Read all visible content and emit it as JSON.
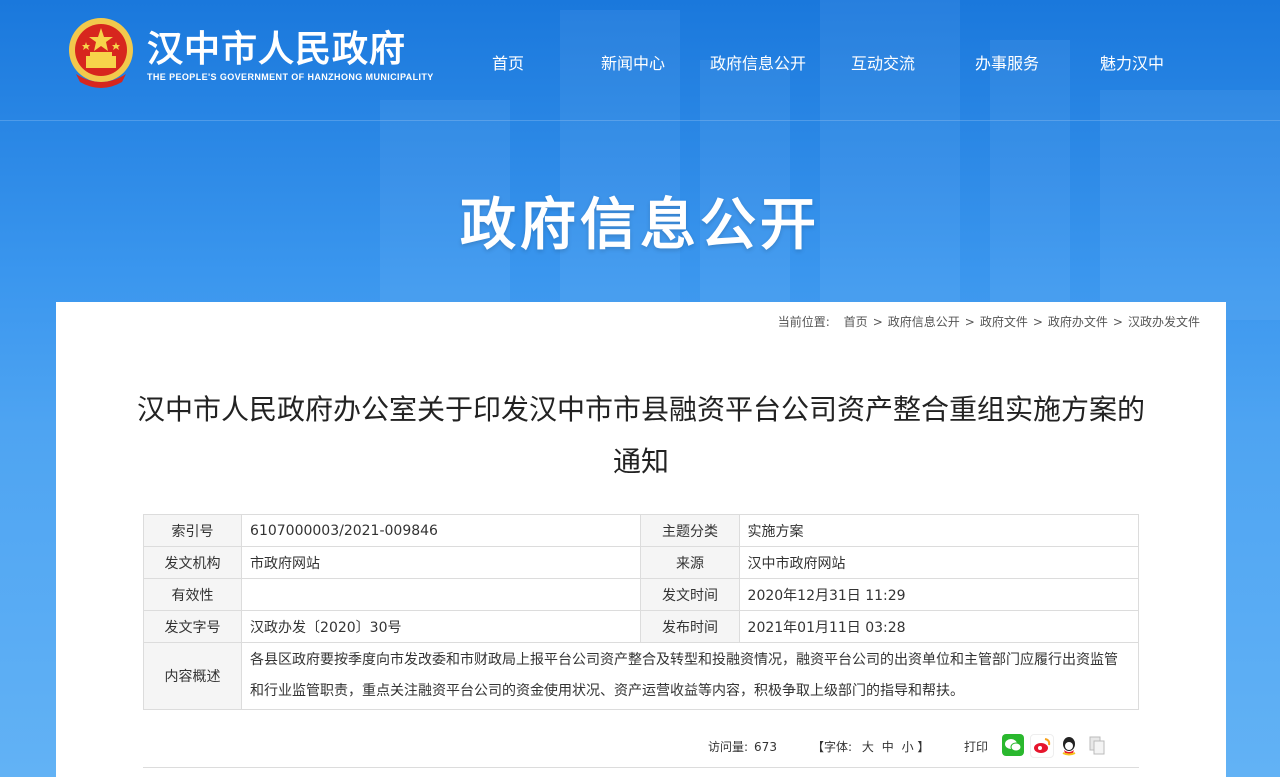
{
  "site": {
    "title": "汉中市人民政府",
    "subtitle": "THE PEOPLE'S GOVERNMENT OF HANZHONG MUNICIPALITY"
  },
  "nav": [
    {
      "label": "首页"
    },
    {
      "label": "新闻中心"
    },
    {
      "label": "政府信息公开"
    },
    {
      "label": "互动交流"
    },
    {
      "label": "办事服务"
    },
    {
      "label": "魅力汉中"
    }
  ],
  "banner": {
    "title": "政府信息公开"
  },
  "breadcrumb": {
    "prefix": "当前位置:",
    "items": [
      "首页",
      "政府信息公开",
      "政府文件",
      "政府办文件",
      "汉政办发文件"
    ]
  },
  "document": {
    "title": "汉中市人民政府办公室关于印发汉中市市县融资平台公司资产整合重组实施方案的通知"
  },
  "meta": {
    "index_label": "索引号",
    "index_value": "6107000003/2021-009846",
    "topic_label": "主题分类",
    "topic_value": "实施方案",
    "issuer_label": "发文机构",
    "issuer_value": "市政府网站",
    "source_label": "来源",
    "source_value": "汉中市政府网站",
    "validity_label": "有效性",
    "validity_value": "",
    "issue_time_label": "发文时间",
    "issue_time_value": "2020年12月31日 11:29",
    "doc_no_label": "发文字号",
    "doc_no_value": "汉政办发〔2020〕30号",
    "publish_time_label": "发布时间",
    "publish_time_value": "2021年01月11日 03:28",
    "summary_label": "内容概述",
    "summary_value": "各县区政府要按季度向市发改委和市财政局上报平台公司资产整合及转型和投融资情况，融资平台公司的出资单位和主管部门应履行出资监管和行业监管职责，重点关注融资平台公司的资金使用状况、资产运营收益等内容，积极争取上级部门的指导和帮扶。"
  },
  "footer": {
    "visits_label": "访问量:",
    "visits_value": "673",
    "font_label": "【字体:",
    "font_large": "大",
    "font_medium": "中",
    "font_small": "小",
    "font_close": "】",
    "print_label": "打印"
  },
  "colors": {
    "wechat": "#2ab82e",
    "weibo": "#e6162d",
    "qq": "#1e90ff"
  }
}
